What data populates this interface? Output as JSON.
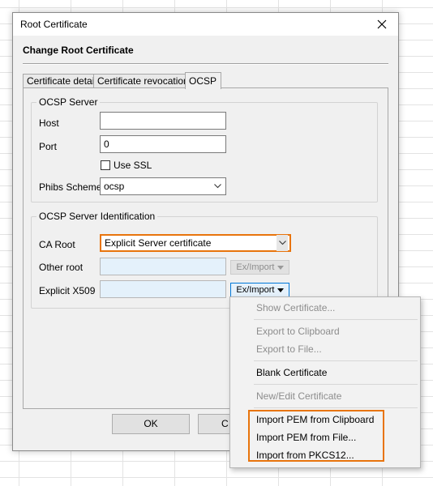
{
  "window": {
    "title": "Root Certificate",
    "close_icon": "close-icon"
  },
  "header": {
    "title": "Change Root Certificate"
  },
  "tabs": [
    {
      "label": "Certificate details",
      "active": false
    },
    {
      "label": "Certificate revocation",
      "active": false
    },
    {
      "label": "OCSP",
      "active": true
    }
  ],
  "ocsp_server": {
    "group_title": "OCSP Server",
    "host_label": "Host",
    "host_value": "",
    "port_label": "Port",
    "port_value": "0",
    "use_ssl_label": "Use SSL",
    "use_ssl_checked": false,
    "scheme_label": "Phibs Scheme",
    "scheme_value": "ocsp"
  },
  "identification": {
    "group_title": "OCSP Server Identification",
    "ca_root_label": "CA Root",
    "ca_root_value": "Explicit Server certificate",
    "other_root_label": "Other root",
    "other_root_value": "",
    "other_root_button": "Ex/Import",
    "explicit_label": "Explicit X509",
    "explicit_value": "",
    "explicit_button": "Ex/Import"
  },
  "footer": {
    "ok_label": "OK",
    "cancel_label": "C"
  },
  "menu": {
    "items": [
      {
        "label": "Show Certificate...",
        "enabled": false
      },
      {
        "label": "Export to Clipboard",
        "enabled": false
      },
      {
        "label": "Export to File...",
        "enabled": false
      },
      {
        "label": "Blank Certificate",
        "enabled": true
      },
      {
        "label": "New/Edit Certificate",
        "enabled": false
      },
      {
        "label": "Import PEM from Clipboard",
        "enabled": true
      },
      {
        "label": "Import PEM from File...",
        "enabled": true
      },
      {
        "label": "Import from PKCS12...",
        "enabled": true
      }
    ]
  },
  "colors": {
    "highlight": "#e8740c",
    "disabled_field": "#e4f1fb",
    "dialog_bg": "#f0f0f0"
  }
}
